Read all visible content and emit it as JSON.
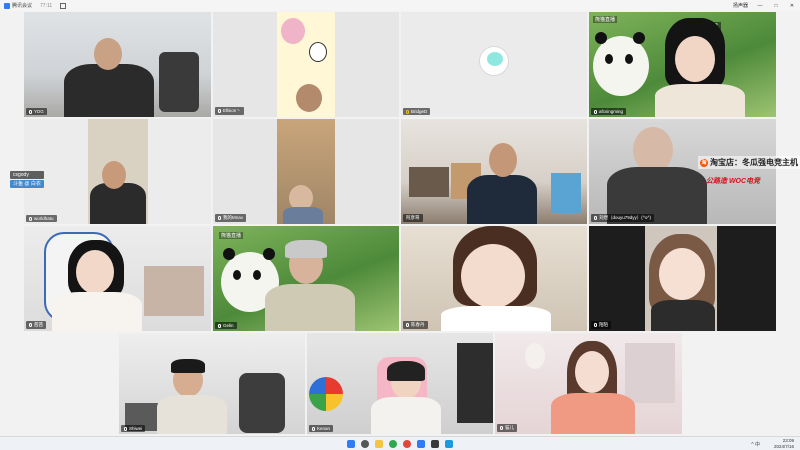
{
  "window": {
    "app_title": "腾讯会议",
    "timer": "77:11",
    "speaker_btn": "扬声器",
    "minimize": "—",
    "maximize": "□",
    "close": "✕"
  },
  "stickers": {
    "top_right_panda": "熊猫直播",
    "mid_panda": "熊猫直播",
    "bridge_top": "正在讲话"
  },
  "participants": [
    {
      "name": "YDG"
    },
    {
      "name": "Ellsion丶"
    },
    {
      "name": "BridgeD"
    },
    {
      "name": "afcsingming"
    },
    {
      "name": "worldhatu"
    },
    {
      "name": "我的Mnax"
    },
    {
      "name": "阿彦哥"
    },
    {
      "name": "刘煜（douyu79dyy）(^o^)"
    },
    {
      "name": "茜茜"
    },
    {
      "name": "Gelin"
    },
    {
      "name": "陈春丹"
    },
    {
      "name": "陌陌"
    },
    {
      "name": "Shiwei"
    },
    {
      "name": "Kenan"
    },
    {
      "name": "猫儿"
    }
  ],
  "overlays": {
    "left_tag1": "csgody",
    "left_tag2": "斗鱼 @ 白衣",
    "taobao": "淘宝店：冬瓜强电竞主机",
    "woc": "公路造 WOC电竞"
  },
  "taskbar": {
    "time": "23:09",
    "date": "2024/7/16",
    "tray": "^ 中"
  },
  "colors": {
    "accent": "#2f7cf6",
    "label_bg": "#000000",
    "woc_red": "#d8101d"
  }
}
